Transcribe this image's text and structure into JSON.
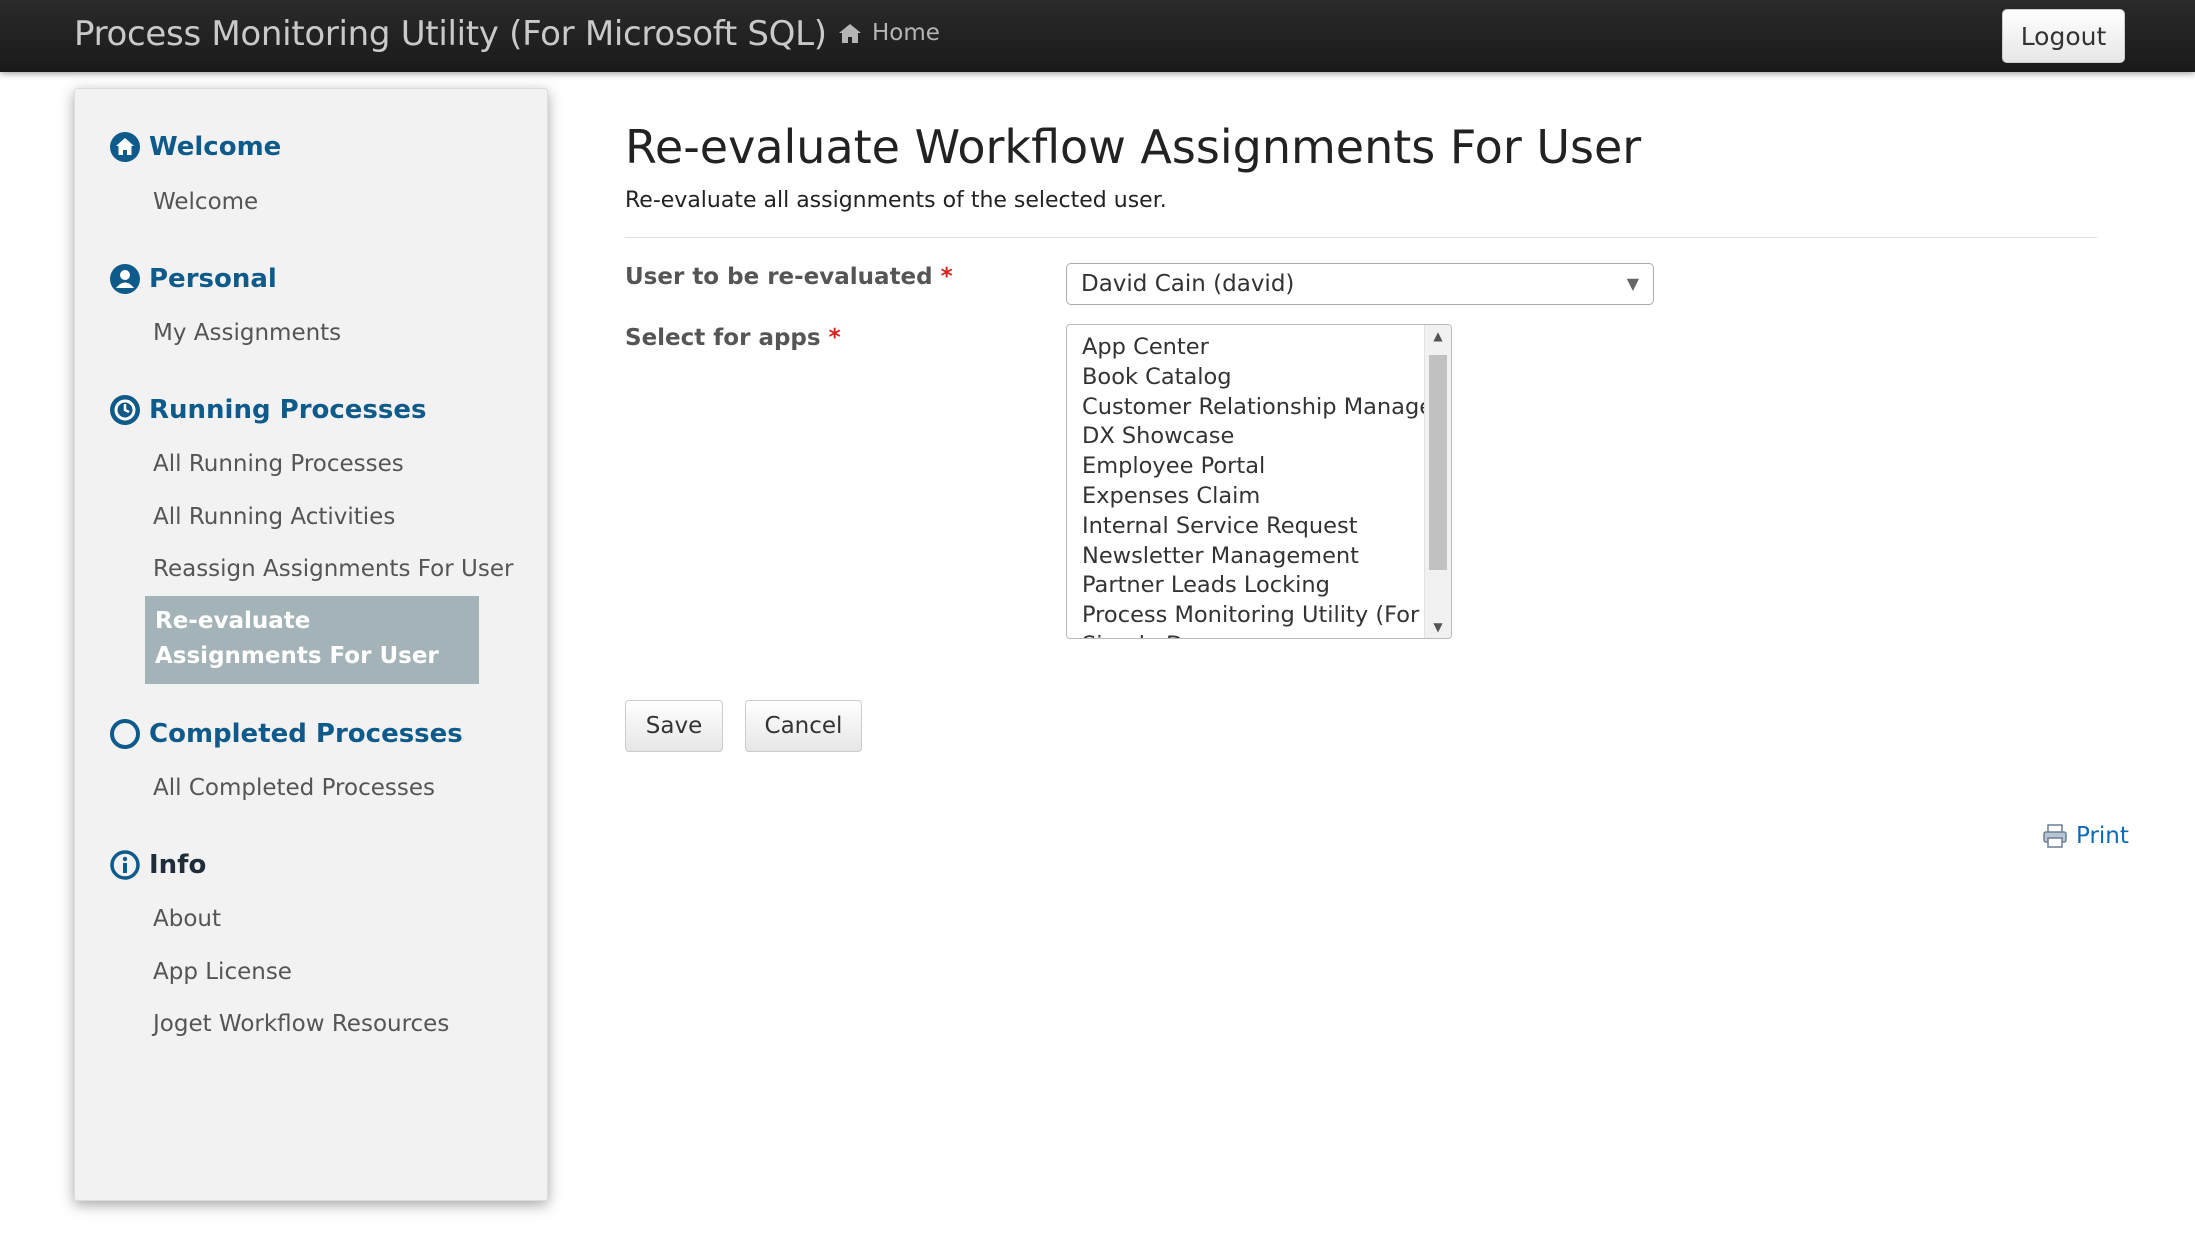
{
  "navbar": {
    "brand": "Process Monitoring Utility (For Microsoft SQL)",
    "home_label": "Home",
    "logout_label": "Logout"
  },
  "sidebar": {
    "sections": [
      {
        "title": "Welcome",
        "icon": "home-icon",
        "items": [
          "Welcome"
        ]
      },
      {
        "title": "Personal",
        "icon": "user-icon",
        "items": [
          "My Assignments"
        ]
      },
      {
        "title": "Running Processes",
        "icon": "clock-icon",
        "items": [
          "All Running Processes",
          "All Running Activities",
          "Reassign Assignments For User",
          "Re-evaluate Assignments For User"
        ]
      },
      {
        "title": "Completed Processes",
        "icon": "circle-icon",
        "items": [
          "All Completed Processes"
        ]
      },
      {
        "title": "Info",
        "icon": "info-icon",
        "items": [
          "About",
          "App License",
          "Joget Workflow Resources"
        ]
      }
    ],
    "active_item": "Re-evaluate Assignments For User"
  },
  "main": {
    "title": "Re-evaluate Workflow Assignments For User",
    "description": "Re-evaluate all assignments of the selected user.",
    "user_field": {
      "label": "User to be re-evaluated",
      "required_mark": "*",
      "value": "David Cain (david)"
    },
    "apps_field": {
      "label": "Select for apps",
      "required_mark": "*",
      "options": [
        "App Center",
        "Book Catalog",
        "Customer Relationship Management",
        "DX Showcase",
        "Employee Portal",
        "Expenses Claim",
        "Internal Service Request",
        "Newsletter Management",
        "Partner Leads Locking",
        "Process Monitoring Utility (For Microsoft SQL)",
        "Simple Demo"
      ]
    },
    "save_label": "Save",
    "cancel_label": "Cancel",
    "print_label": "Print"
  },
  "colors": {
    "navbar": "#1f1f1f",
    "section_title": "#0e5a8a",
    "active_item_bg": "#a3b3b8",
    "required": "#d9211c",
    "link": "#0e6ab8"
  }
}
